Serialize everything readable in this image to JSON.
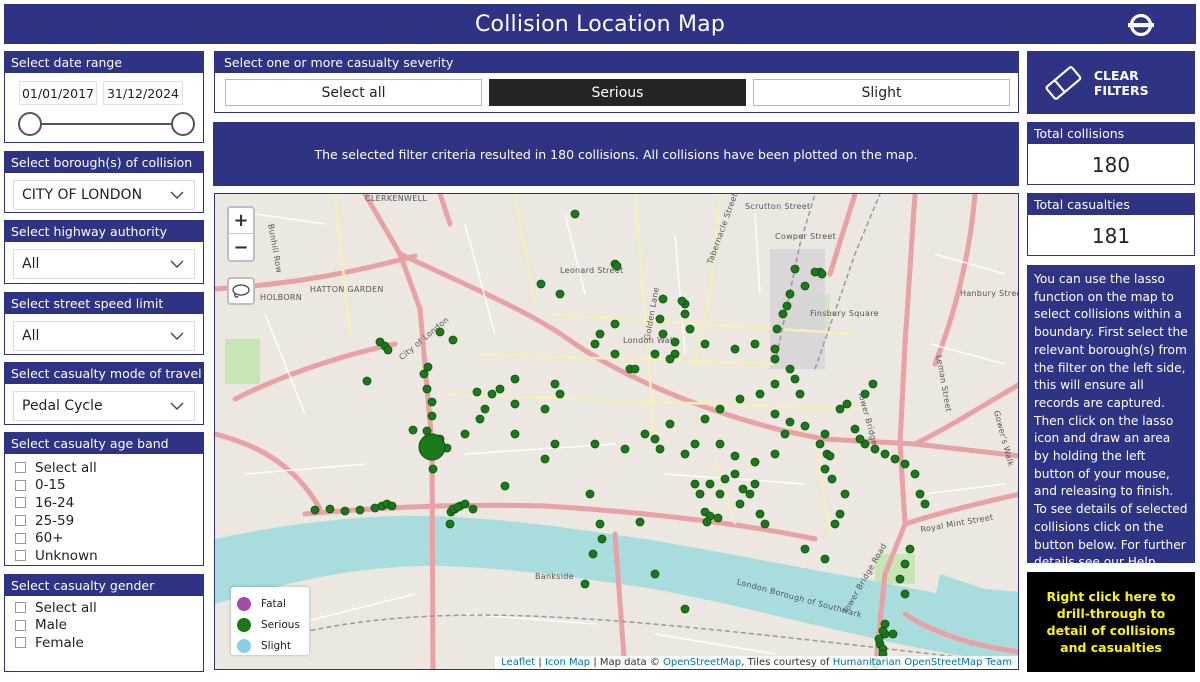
{
  "header": {
    "title": "Collision Location Map",
    "logo": "tfl-roundel-icon"
  },
  "date_range": {
    "label": "Select date range",
    "start": "01/01/2017",
    "end": "31/12/2024"
  },
  "borough": {
    "label": "Select borough(s) of collision",
    "value": "CITY OF LONDON"
  },
  "highway": {
    "label": "Select highway authority",
    "value": "All"
  },
  "speed": {
    "label": "Select street speed limit",
    "value": "All"
  },
  "mode": {
    "label": "Select casualty mode of travel",
    "value": "Pedal Cycle"
  },
  "age": {
    "label": "Select casualty age band",
    "options": [
      "Select all",
      "0-15",
      "16-24",
      "25-59",
      "60+",
      "Unknown"
    ]
  },
  "gender": {
    "label": "Select casualty gender",
    "options": [
      "Select all",
      "Male",
      "Female"
    ]
  },
  "severity": {
    "label": "Select one or more casualty severity",
    "buttons": [
      "Select all",
      "Serious",
      "Slight"
    ],
    "selected": "Serious"
  },
  "info": {
    "text": "The selected filter criteria resulted in 180 collisions. All collisions have been plotted on the map."
  },
  "map": {
    "zoom_in": "+",
    "zoom_out": "−",
    "labels": [
      "CLERKENWELL",
      "HATTON GARDEN",
      "HOLBORN",
      "City of London",
      "London Wall",
      "Bankside",
      "Tabernacle Street",
      "Scrutton Street",
      "Leonard Street",
      "Bunhill Row",
      "Golden Lane",
      "Cowper Street",
      "Finsbury Square",
      "London Borough of Southwark",
      "Tower Bridge",
      "Gower's Walk",
      "Royal Mint Street",
      "Leman Street",
      "Hanbury Street",
      "Tower Bridge Road"
    ],
    "legend": [
      {
        "label": "Fatal",
        "color": "#a64ca6"
      },
      {
        "label": "Serious",
        "color": "#1a7a1a"
      },
      {
        "label": "Slight",
        "color": "#87ceeb"
      }
    ],
    "attribution": {
      "leaflet": "Leaflet",
      "sep1": " | ",
      "iconmap": "Icon Map",
      "sep2": " | Map data © ",
      "osm": "OpenStreetMap",
      "tiles": ", Tiles courtesy of ",
      "hot": "Humanitarian OpenStreetMap Team"
    },
    "point_color": "#1a7a1a"
  },
  "clear_filters": {
    "label": "CLEAR FILTERS"
  },
  "kpis": {
    "collisions": {
      "label": "Total collisions",
      "value": "180"
    },
    "casualties": {
      "label": "Total casualties",
      "value": "181"
    }
  },
  "help": {
    "text": "You can use the lasso function on the map to select collisions within a boundary. First select the relevant borough(s) from the filter on the left side, this will ensure all records are captured. Then click on the lasso icon and draw an area by holding the left button of your mouse, and releasing to finish. To see details of selected collisions click on the button below. For further details see our ",
    "link": "Help Document",
    "end": "."
  },
  "drill": {
    "label": "Right click here to drill-through to detail of collisions and casualties"
  }
}
